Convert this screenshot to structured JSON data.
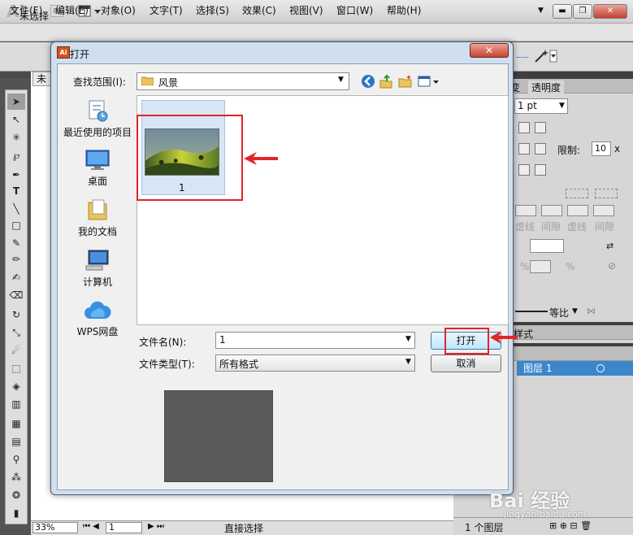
{
  "app": {
    "logo": "Ai",
    "bridge": "Br",
    "window_controls": {
      "minimize": "▬",
      "restore": "❐",
      "close": "✕"
    },
    "menu": [
      "文件(F)",
      "编辑(E)",
      "对象(O)",
      "文字(T)",
      "选择(S)",
      "效果(C)",
      "视图(V)",
      "窗口(W)",
      "帮助(H)"
    ],
    "control_bar": {
      "no_selection": "未选择"
    },
    "doc_tab": "未",
    "status": {
      "zoom": "33%",
      "page": "1",
      "tool": "直接选择"
    }
  },
  "right_panel": {
    "tab_transparency": "透明度",
    "tab_left": "变",
    "stroke_weight": "1 pt",
    "limit_label": "限制:",
    "limit_value": "10",
    "limit_unit": "x",
    "dash_labels": [
      "虚线",
      "间隙",
      "虚线",
      "间隙"
    ],
    "percent": "%",
    "ratio_label": "等比",
    "style_tab": "样式",
    "layer_name": "图层 1",
    "layers_count": "1 个图层"
  },
  "dialog": {
    "title": "打开",
    "close": "✕",
    "look_in_label": "查找范围(I):",
    "look_in_value": "风景",
    "places": [
      {
        "label": "最近使用的项目",
        "icon": "recent-items-icon"
      },
      {
        "label": "桌面",
        "icon": "desktop-icon"
      },
      {
        "label": "我的文档",
        "icon": "my-documents-icon"
      },
      {
        "label": "计算机",
        "icon": "computer-icon"
      },
      {
        "label": "WPS网盘",
        "icon": "wps-cloud-icon"
      }
    ],
    "files": [
      {
        "name": "1",
        "thumbnail": "landscape-thumbnail"
      }
    ],
    "file_name_label": "文件名(N):",
    "file_name_value": "1",
    "file_type_label": "文件类型(T):",
    "file_type_value": "所有格式",
    "open_button": "打开",
    "cancel_button": "取消"
  },
  "annotations": {
    "highlight_color": "#e0262a"
  },
  "watermark": {
    "main": "Bai 经验",
    "sub": "jingyan.baidu.com"
  }
}
